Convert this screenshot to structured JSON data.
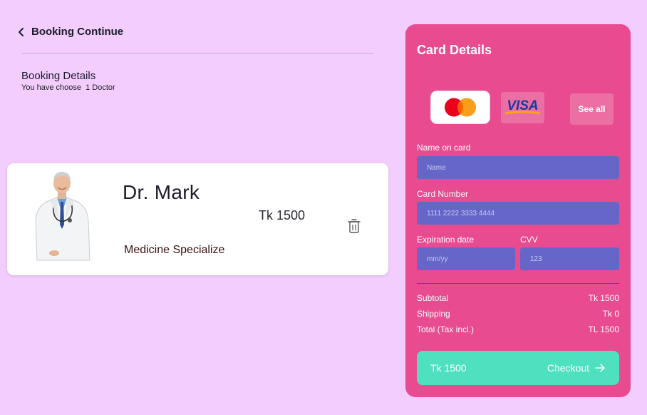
{
  "header": {
    "title": "Booking Continue",
    "back_icon": "chevron-left-icon"
  },
  "booking": {
    "title": "Booking Details",
    "subtitle": "You have choose  1 Doctor"
  },
  "doctor": {
    "name": "Dr. Mark",
    "price": "Tk 1500",
    "specialty": "Medicine Specialize",
    "photo_icon": "doctor-avatar",
    "delete_icon": "trash-icon"
  },
  "card_panel": {
    "title": "Card Details",
    "methods": [
      {
        "name": "mastercard",
        "icon": "mastercard-logo"
      },
      {
        "name": "visa",
        "label": "VISA",
        "icon": "visa-logo"
      }
    ],
    "see_all": "See all",
    "name_label": "Name on card",
    "name_placeholder": "Name",
    "number_label": "Card Number",
    "number_placeholder": "1111 2222 3333 4444",
    "expiry_label": "Expiration date",
    "expiry_placeholder": "mm/yy",
    "cvv_label": "CVV",
    "cvv_placeholder": "123"
  },
  "summary": {
    "subtotal_label": "Subtotal",
    "subtotal_value": "Tk 1500",
    "shipping_label": "Shipping",
    "shipping_value": "Tk 0",
    "total_label": "Total (Tax incl.)",
    "total_value": "TL 1500"
  },
  "checkout": {
    "amount": "Tk 1500",
    "label": "Checkout",
    "icon": "arrow-right-icon"
  },
  "colors": {
    "background": "#f2cdfd",
    "panel": "#e84b8f",
    "input": "#6566c7",
    "checkout": "#4fe0c0"
  }
}
